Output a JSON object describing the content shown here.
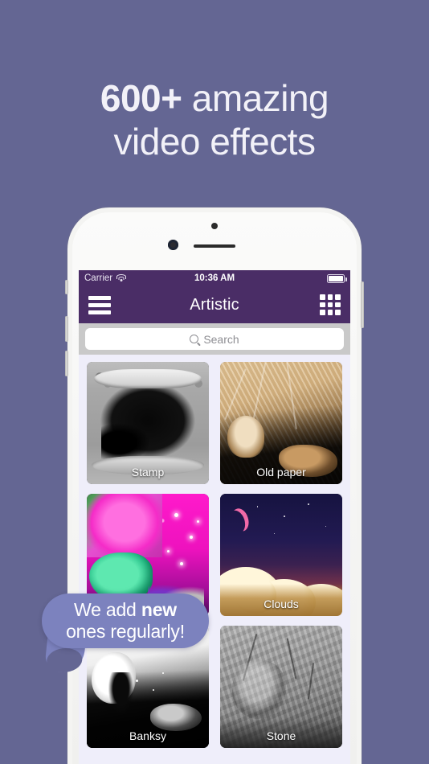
{
  "headline": {
    "line1_bold": "600+",
    "line1_rest": " amazing",
    "line2": "video effects"
  },
  "colors": {
    "background": "#646693",
    "navbar": "#4A2D66",
    "screen_background": "#EFEEFA",
    "callout": "#7C82BE",
    "search_field": "#FFFFFF",
    "search_bar_tray": "#C9C9C9"
  },
  "phone": {
    "status_bar": {
      "carrier": "Carrier",
      "wifi_icon": "wifi-icon",
      "time": "10:36 AM",
      "battery_icon": "battery-icon"
    },
    "nav_bar": {
      "menu_icon": "hamburger-menu-icon",
      "title": "Artistic",
      "grid_icon": "grid-view-icon"
    },
    "search": {
      "icon": "search-icon",
      "placeholder": "Search",
      "value": ""
    },
    "effects": [
      {
        "label": "Stamp",
        "art": "art-stamp"
      },
      {
        "label": "Old paper",
        "art": "art-oldpaper"
      },
      {
        "label": "",
        "art": "art-neon"
      },
      {
        "label": "Clouds",
        "art": "art-clouds"
      },
      {
        "label": "Banksy",
        "art": "art-banksy"
      },
      {
        "label": "Stone",
        "art": "art-stone"
      }
    ]
  },
  "callout": {
    "line1_prefix": "We add ",
    "line1_bold": "new",
    "line2": "ones regularly!"
  }
}
